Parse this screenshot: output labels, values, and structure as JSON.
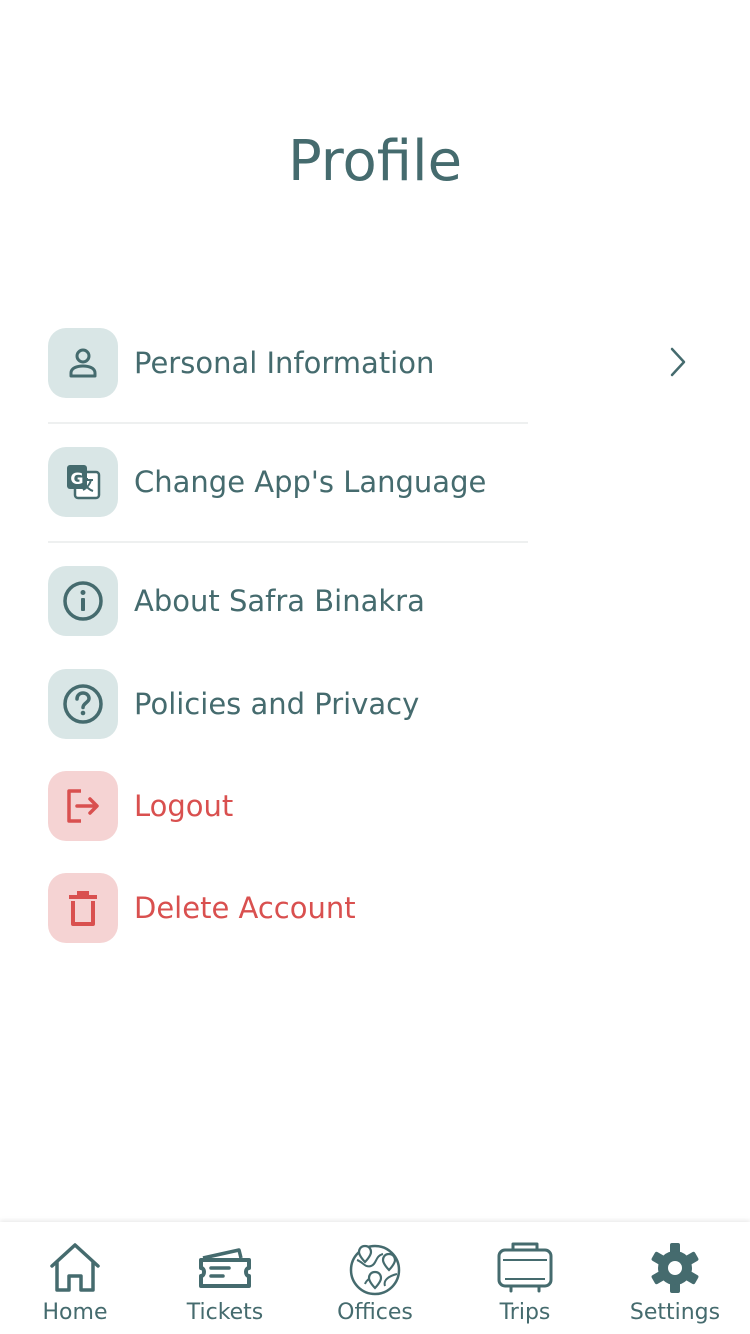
{
  "header": {
    "title": "Profile"
  },
  "menu": {
    "items": [
      {
        "label": "Personal Information",
        "icon": "person-icon",
        "tone": "neutral",
        "chevron": true
      },
      {
        "label": "Change App's Language",
        "icon": "translate-icon",
        "tone": "neutral"
      },
      {
        "label": "About Safra Binakra",
        "icon": "info-icon",
        "tone": "neutral"
      },
      {
        "label": "Policies and Privacy",
        "icon": "question-icon",
        "tone": "neutral"
      },
      {
        "label": "Logout",
        "icon": "logout-icon",
        "tone": "danger"
      },
      {
        "label": "Delete Account",
        "icon": "trash-icon",
        "tone": "danger"
      }
    ]
  },
  "tabbar": {
    "tabs": [
      {
        "label": "Home",
        "icon": "home-icon"
      },
      {
        "label": "Tickets",
        "icon": "ticket-icon"
      },
      {
        "label": "Offices",
        "icon": "globe-icon"
      },
      {
        "label": "Trips",
        "icon": "bus-icon"
      },
      {
        "label": "Settings",
        "icon": "gear-icon",
        "active": true
      }
    ]
  },
  "colors": {
    "primary": "#456b6e",
    "neutral_bg": "#d9e6e6",
    "danger": "#d9504f",
    "danger_bg": "#f5d3d3"
  }
}
